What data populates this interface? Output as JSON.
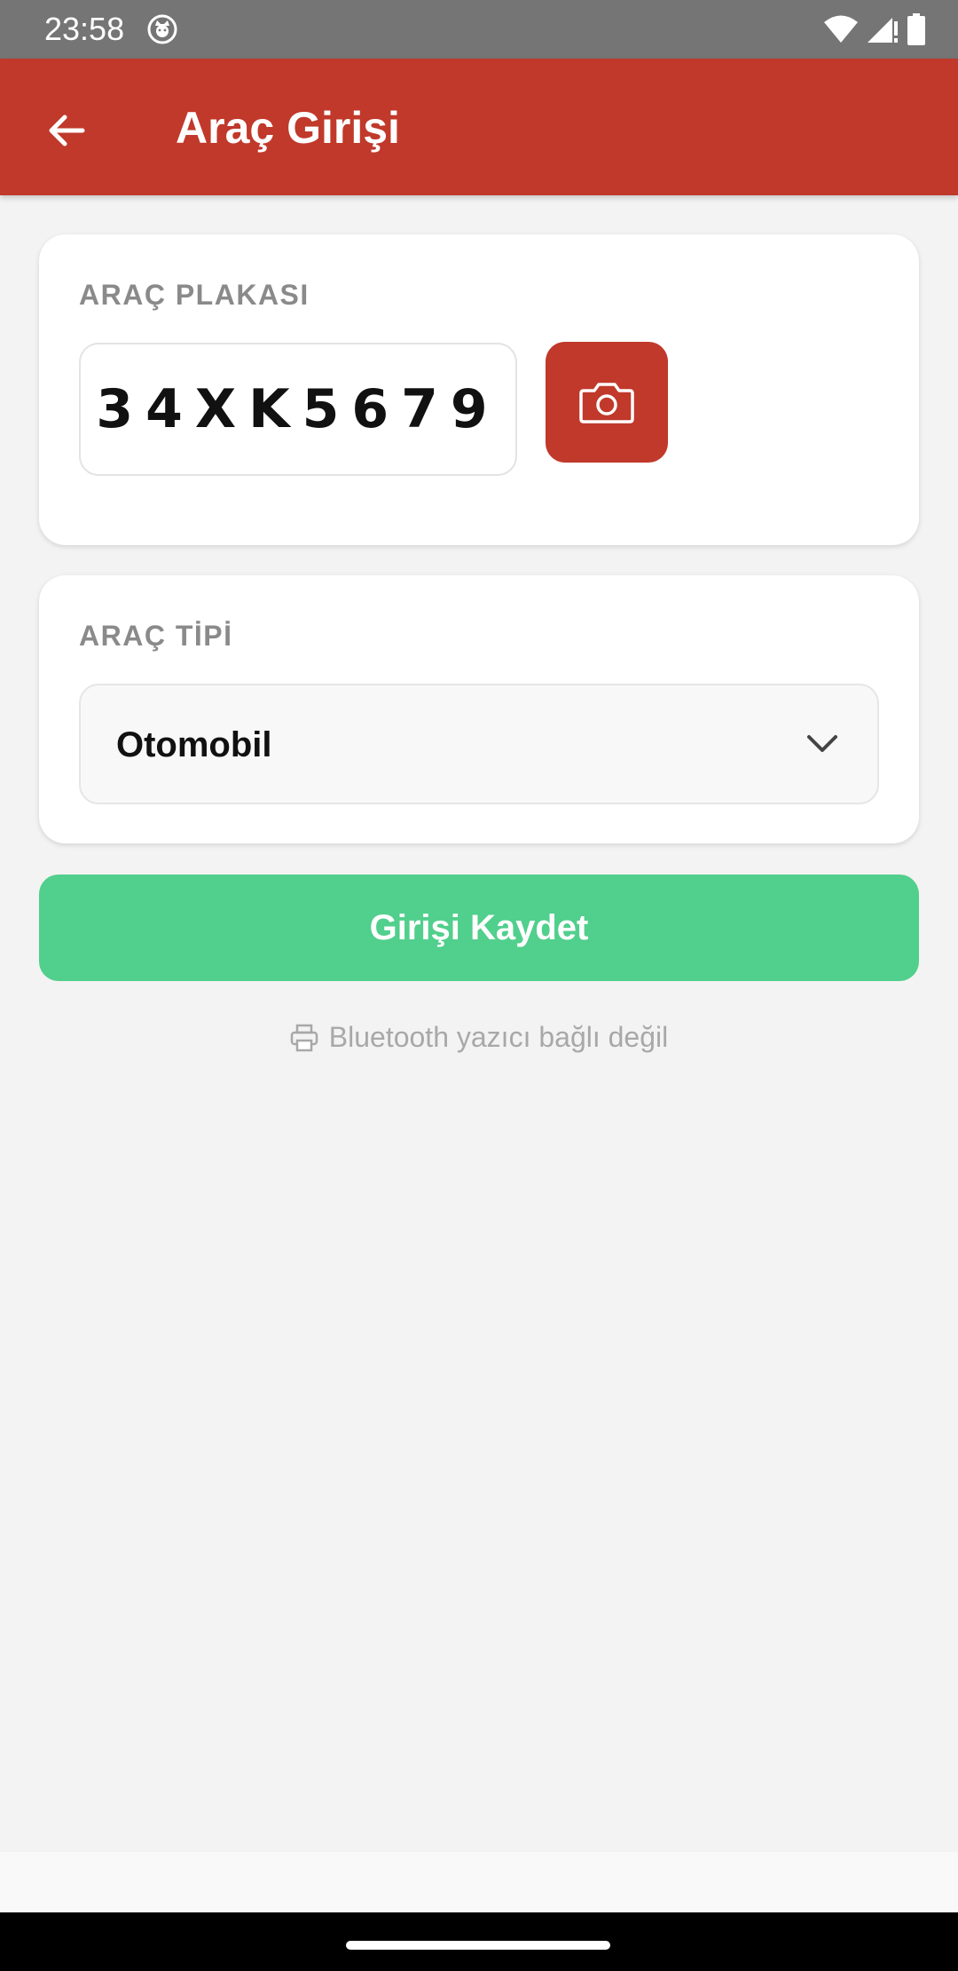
{
  "status_bar": {
    "time": "23:58",
    "icons": [
      "cat-notification-icon",
      "wifi-icon",
      "signal-icon",
      "battery-icon"
    ]
  },
  "app_bar": {
    "title": "Araç Girişi",
    "back_icon": "arrow-left-icon",
    "color": "#c0392b"
  },
  "plate_section": {
    "label": "ARAÇ PLAKASI",
    "plate_value": "34XK5679",
    "camera_icon": "camera-icon"
  },
  "type_section": {
    "label": "ARAÇ TİPİ",
    "selected": "Otomobil",
    "chevron_icon": "chevron-down-icon"
  },
  "save_button": {
    "label": "Girişi Kaydet",
    "color": "#51cf8c"
  },
  "printer": {
    "icon": "printer-icon",
    "status": "Bluetooth yazıcı bağlı değil"
  }
}
